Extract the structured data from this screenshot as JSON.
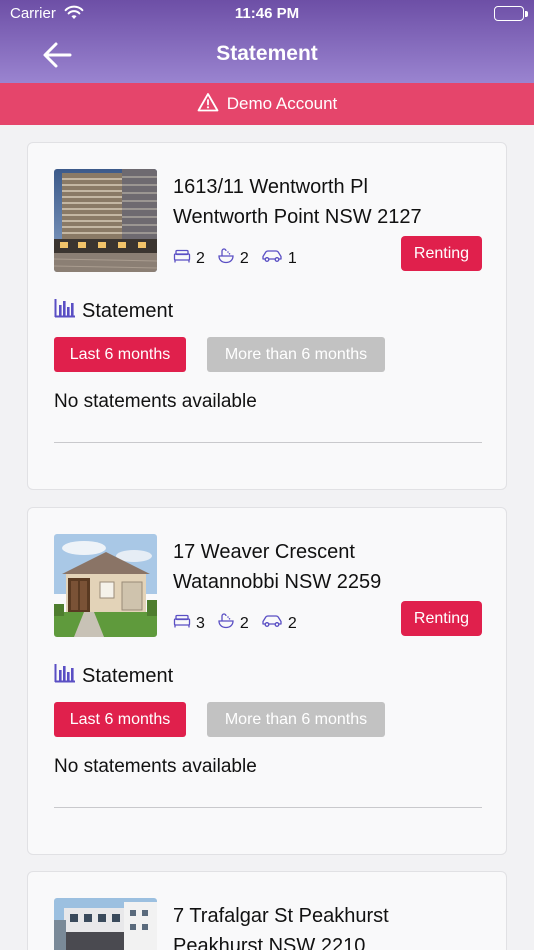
{
  "statusbar": {
    "carrier": "Carrier",
    "time": "11:46 PM"
  },
  "header": {
    "title": "Statement"
  },
  "banner": {
    "label": "Demo Account"
  },
  "colors": {
    "accent": "#e0204c",
    "header_top": "#6d4fa6",
    "header_bottom": "#9a84d0",
    "banner": "#e5456b",
    "disabled": "#c2c2c2"
  },
  "properties": [
    {
      "line1": "1613/11 Wentworth Pl",
      "line2": "Wentworth Point NSW 2127",
      "beds": "2",
      "baths": "2",
      "cars": "1",
      "status": "Renting",
      "statement_label": "Statement",
      "tab_recent": "Last 6 months",
      "tab_older": "More than 6 months",
      "empty_text": "No statements available"
    },
    {
      "line1": "17 Weaver Crescent",
      "line2": "Watannobbi NSW 2259",
      "beds": "3",
      "baths": "2",
      "cars": "2",
      "status": "Renting",
      "statement_label": "Statement",
      "tab_recent": "Last 6 months",
      "tab_older": "More than 6 months",
      "empty_text": "No statements available"
    },
    {
      "line1": "7 Trafalgar St Peakhurst",
      "line2": "Peakhurst NSW 2210"
    }
  ]
}
